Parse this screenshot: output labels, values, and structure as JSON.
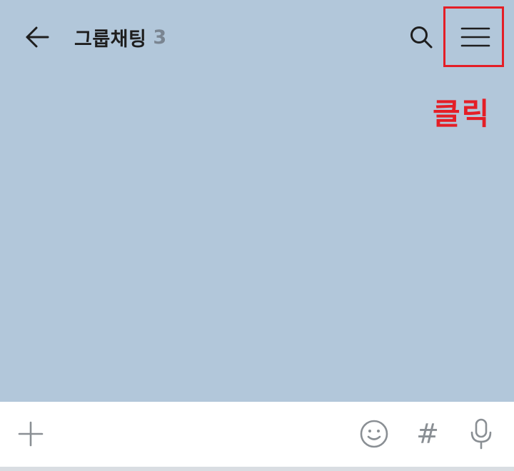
{
  "header": {
    "room_name": "그룹채팅",
    "member_count": "3",
    "back_icon": "arrow-left-icon",
    "search_icon": "search-icon",
    "menu_icon": "hamburger-menu-icon"
  },
  "annotation": {
    "label": "클릭",
    "color": "#e41e26"
  },
  "input_bar": {
    "message_value": "",
    "hashtag_glyph": "#",
    "plus_icon": "plus-icon",
    "emoji_icon": "emoji-icon",
    "mic_icon": "microphone-icon"
  },
  "colors": {
    "chat_background": "#b2c7da",
    "input_background": "#ffffff",
    "icon_gray": "#8a8f94"
  }
}
